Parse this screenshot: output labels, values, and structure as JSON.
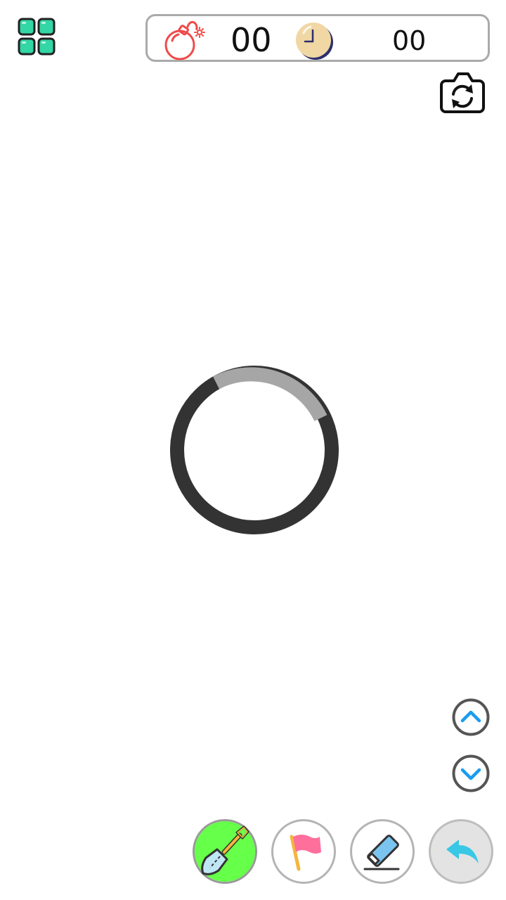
{
  "app": {
    "menu_icon": "grid-menu-icon",
    "camera_icon": "camera-switch-icon"
  },
  "status": {
    "mine_count": "00",
    "timer": "00",
    "bomb_icon": "bomb-icon",
    "clock_icon": "clock-icon"
  },
  "loading": {
    "indicator": "loading-spinner"
  },
  "navigation": {
    "up_icon": "chevron-up-icon",
    "down_icon": "chevron-down-icon"
  },
  "tools": [
    {
      "name": "dig",
      "icon": "shovel-icon",
      "active": true
    },
    {
      "name": "flag",
      "icon": "flag-icon",
      "active": false
    },
    {
      "name": "erase",
      "icon": "eraser-icon",
      "active": false
    },
    {
      "name": "undo",
      "icon": "undo-icon",
      "active": false
    }
  ],
  "colors": {
    "accent_green": "#33d6a5",
    "dig_active": "#66ff4a",
    "bomb_red": "#f04a4a",
    "flag_pink": "#ff6f9c",
    "eraser_blue": "#7cc4f0",
    "undo_cyan": "#38c8e6",
    "nav_blue": "#1a9cf0",
    "spinner_dark": "#333333",
    "spinner_light": "#a6a6a6"
  }
}
